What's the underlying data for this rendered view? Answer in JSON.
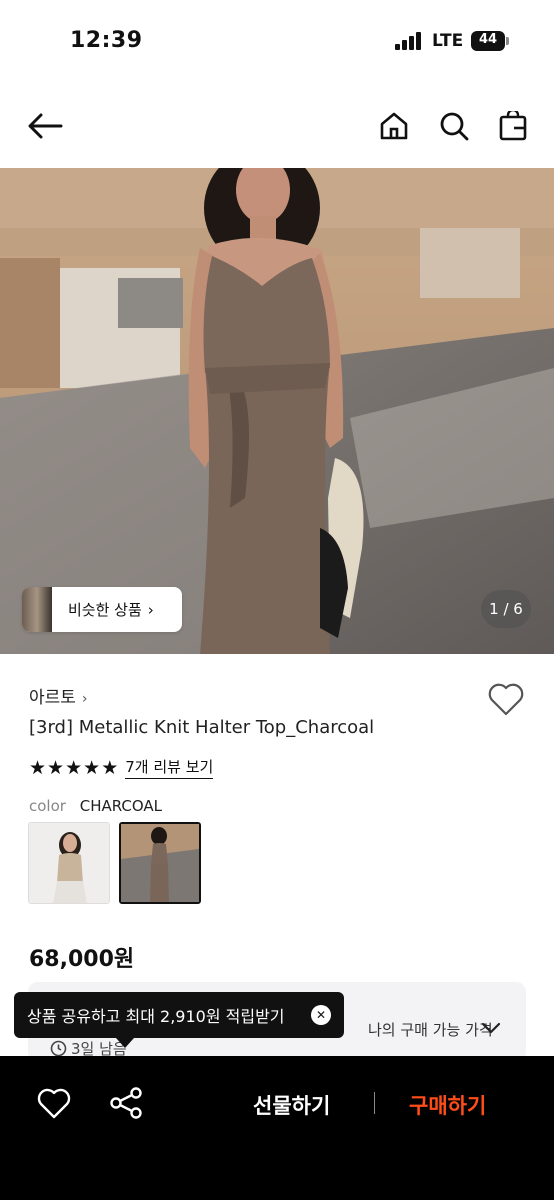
{
  "status_bar": {
    "time": "12:39",
    "network": "LTE",
    "battery": "44"
  },
  "nav": {
    "back_icon": "arrow-left-icon",
    "home_icon": "home-icon",
    "search_icon": "search-icon",
    "bag_icon": "shopping-bag-icon"
  },
  "hero": {
    "similar_label": "비슷한 상품",
    "similar_chevron": "›",
    "page_counter": "1 / 6"
  },
  "product": {
    "brand": "아르토",
    "brand_chevron": "›",
    "title": "[3rd] Metallic Knit Halter Top_Charcoal",
    "rating_stars": 5,
    "review_link": "7개 리뷰 보기",
    "color_key": "color",
    "color_value": "CHARCOAL",
    "price": "68,000원",
    "possible_price_label": "나의 구매 가능 가격",
    "days_left": "3일 남음"
  },
  "tooltip": {
    "text": "상품 공유하고 최대 2,910원 적립받기",
    "close": "✕"
  },
  "bottom_bar": {
    "gift_label": "선물하기",
    "buy_label": "구매하기"
  },
  "colors": {
    "accent": "#ff4d1a",
    "bottom_bg": "#000000",
    "price_box_bg": "#f3f3f5",
    "dress": "#7a6659"
  }
}
